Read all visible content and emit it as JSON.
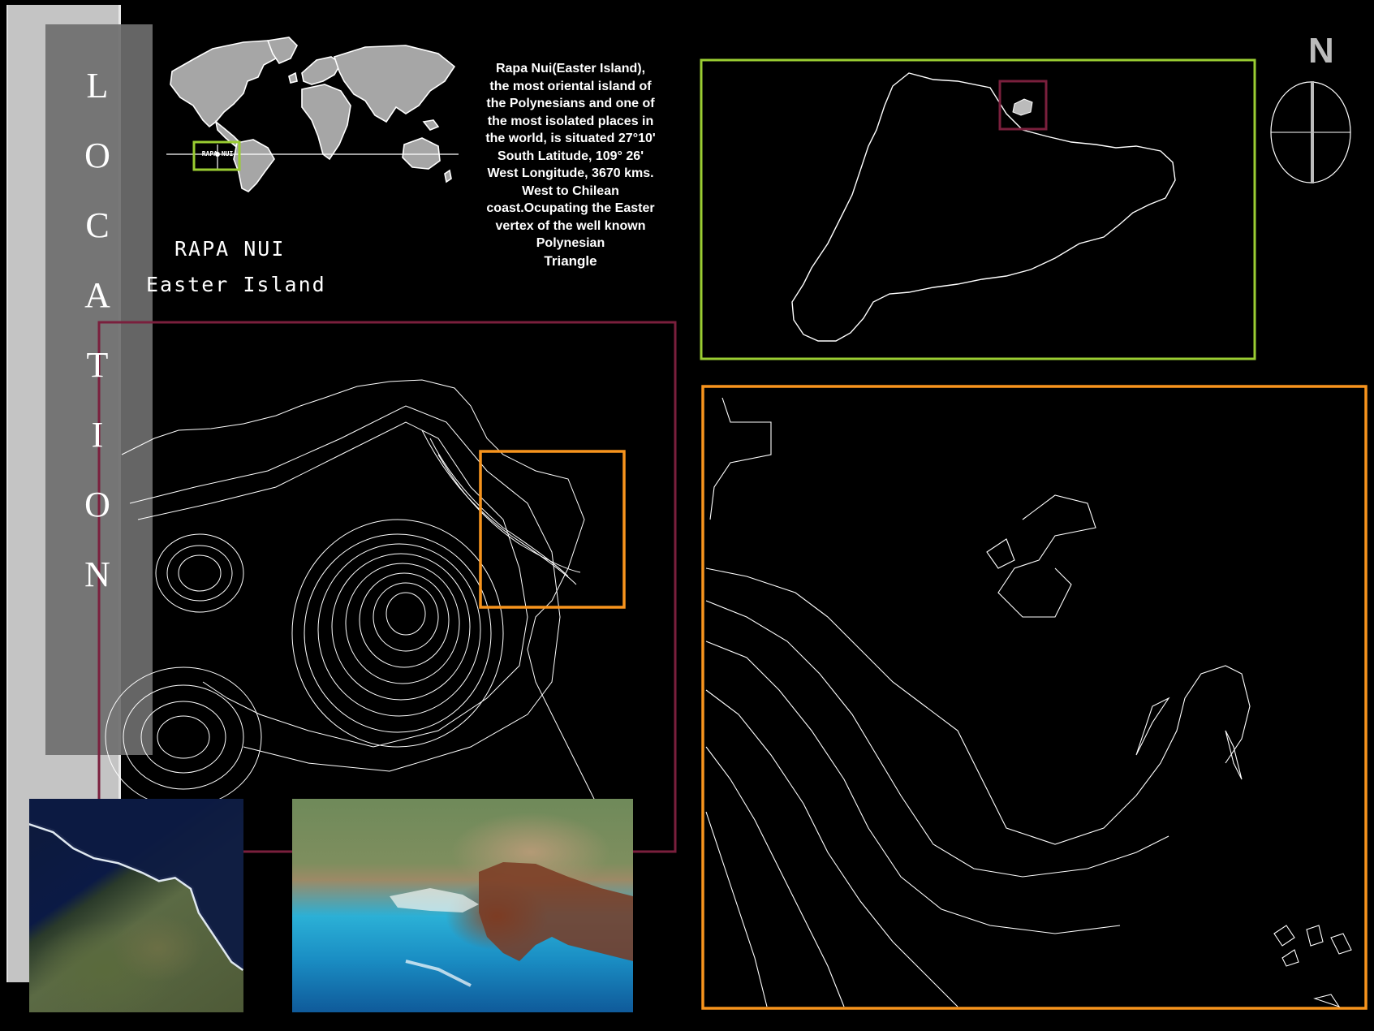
{
  "side_title_letters": [
    "L",
    "O",
    "C",
    "A",
    "T",
    "I",
    "O",
    "N"
  ],
  "title": {
    "line1": "RAPA NUI",
    "line2": "Easter Island"
  },
  "world_map_box_label": "RAPA NUI",
  "description": {
    "text": "Rapa Nui(Easter Island), the most oriental island of the Polynesians and one of the most isolated places in the world, is situated 27°10' South Latitude, 109° 26' West Longitude, 3670 kms. West to Chilean coast.Ocupating the Easter vertex of the well known Polynesian",
    "emphasis": "Triangle"
  },
  "compass": {
    "label": "N"
  },
  "colors": {
    "green_frame": "#9acd32",
    "maroon_frame": "#7a1f3d",
    "orange_frame": "#f7941d",
    "background": "#000000",
    "side_panel": "#c4c4c4"
  }
}
